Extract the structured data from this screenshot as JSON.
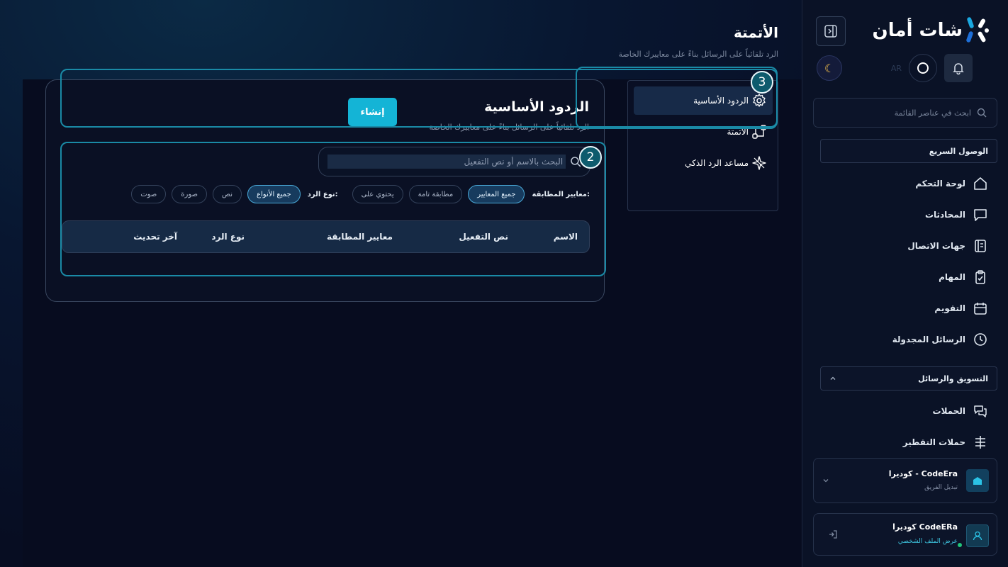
{
  "app": {
    "logo_text": "شات أمان",
    "accent": "#14b4d6"
  },
  "header": {
    "title": "الأتمتة",
    "subtitle": "الرد تلقائياً على الرسائل بناءً على معاييرك الخاصة"
  },
  "sidebar": {
    "ghost_label": "AR",
    "search_placeholder": "ابحث في عناصر القائمة",
    "quick_access_title": "الوصول السريع",
    "items": [
      {
        "label": "لوحة التحكم",
        "icon": "home-icon"
      },
      {
        "label": "المحادثات",
        "icon": "chat-icon"
      },
      {
        "label": "جهات الاتصال",
        "icon": "contacts-icon"
      },
      {
        "label": "المهام",
        "icon": "clipboard-icon"
      },
      {
        "label": "التقويم",
        "icon": "calendar-icon"
      },
      {
        "label": "الرسائل المجدولة",
        "icon": "clock-icon"
      }
    ],
    "marketing_title": "التسويق والرسائل",
    "marketing_items": [
      {
        "label": "الحملات",
        "icon": "campaign-icon"
      },
      {
        "label": "حملات التقطير",
        "icon": "drip-icon"
      }
    ],
    "team": {
      "name": "كوديرا - CodeEra",
      "action": "تبديل الفريق"
    },
    "user": {
      "name": "كوديرا CodeERa",
      "action": "عرض الملف الشخصي"
    }
  },
  "subnav": {
    "items": [
      {
        "label": "الردود الأساسية",
        "active": true
      },
      {
        "label": "الأتمتة",
        "active": false
      },
      {
        "label": "مساعد الرد الذكي",
        "active": false
      }
    ]
  },
  "card": {
    "title": "الردود الأساسية",
    "subtitle": "الرد تلقائياً على الرسائل بناءً على معاييرك الخاصة",
    "create_label": "إنشاء",
    "search_placeholder": "البحث بالاسم أو نص التفعيل",
    "match_label": "معايير المطابقة:",
    "match_options": [
      "جميع المعايير",
      "مطابقة تامة",
      "يحتوي على"
    ],
    "type_label": "نوع الرد:",
    "type_options": [
      "جميع الأنواع",
      "نص",
      "صورة",
      "صوت"
    ],
    "columns": [
      "الاسم",
      "نص التفعيل",
      "معايير المطابقة",
      "نوع الرد",
      "آخر تحديث"
    ]
  },
  "annotations": [
    "2",
    "3"
  ]
}
